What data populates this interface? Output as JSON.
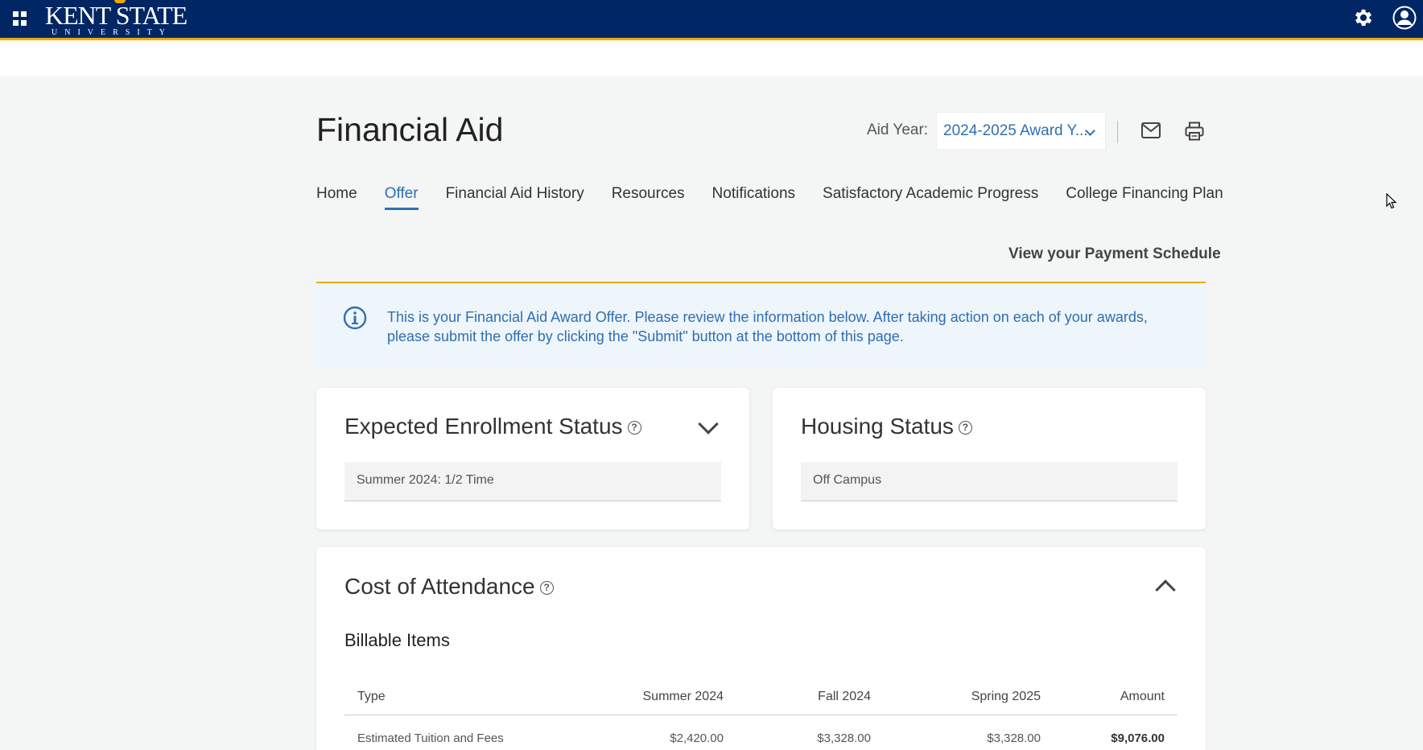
{
  "header": {
    "logo_line1": "KENT STATE",
    "logo_line2": "UNIVERSITY",
    "brand_color": "#002664",
    "accent_color": "#eaab00"
  },
  "page": {
    "title": "Financial Aid",
    "aid_year_label": "Aid Year:",
    "aid_year_value": "2024-2025 Award Y..."
  },
  "tabs": [
    {
      "label": "Home",
      "active": false
    },
    {
      "label": "Offer",
      "active": true
    },
    {
      "label": "Financial Aid History",
      "active": false
    },
    {
      "label": "Resources",
      "active": false
    },
    {
      "label": "Notifications",
      "active": false
    },
    {
      "label": "Satisfactory Academic Progress",
      "active": false
    },
    {
      "label": "College Financing Plan",
      "active": false
    }
  ],
  "payment_link": "View your Payment Schedule",
  "info_banner": {
    "text": "This is your Financial Aid Award Offer. Please review the information below. After taking action on each of your awards, please submit the offer by clicking the \"Submit\" button at the bottom of this page."
  },
  "enrollment": {
    "title": "Expected Enrollment Status",
    "value": "Summer 2024:  1/2 Time"
  },
  "housing": {
    "title": "Housing Status",
    "value": "Off Campus"
  },
  "cost": {
    "title": "Cost of Attendance",
    "subtitle": "Billable Items",
    "columns": [
      "Type",
      "Summer 2024",
      "Fall 2024",
      "Spring 2025",
      "Amount"
    ],
    "rows": [
      [
        "Estimated Tuition and Fees",
        "$2,420.00",
        "$3,328.00",
        "$3,328.00",
        "$9,076.00"
      ]
    ]
  },
  "icons": {
    "help": "?"
  }
}
